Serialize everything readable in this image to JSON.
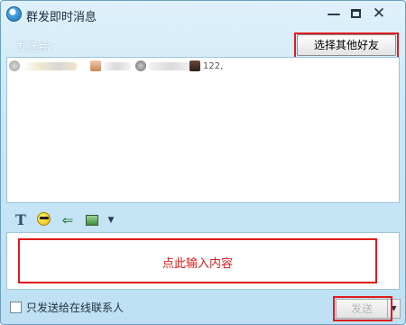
{
  "window": {
    "title": "群发即时消息",
    "minimize_glyph": "—",
    "close_glyph": "✕"
  },
  "recipients": {
    "label": "发送给:",
    "select_button_label": "选择其他好友",
    "chips": [
      {
        "name_text": "",
        "avatar": "avatar"
      },
      {
        "name_text": "",
        "avatar": "avatar"
      },
      {
        "name_text": "",
        "avatar": "avatar"
      },
      {
        "name_text": "122,",
        "avatar": "avatar"
      }
    ]
  },
  "toolbar": {
    "font_glyph": "T",
    "shake_glyph": "⇐",
    "more_glyph": "▼"
  },
  "input": {
    "hint": "点此输入内容"
  },
  "footer": {
    "online_only_label": "只发送给在线联系人",
    "online_only_checked": false,
    "send_label": "发送",
    "send_dropdown_glyph": "▼"
  },
  "colors": {
    "highlight": "#e01b1b",
    "window_bg": "#c9e6f6"
  }
}
